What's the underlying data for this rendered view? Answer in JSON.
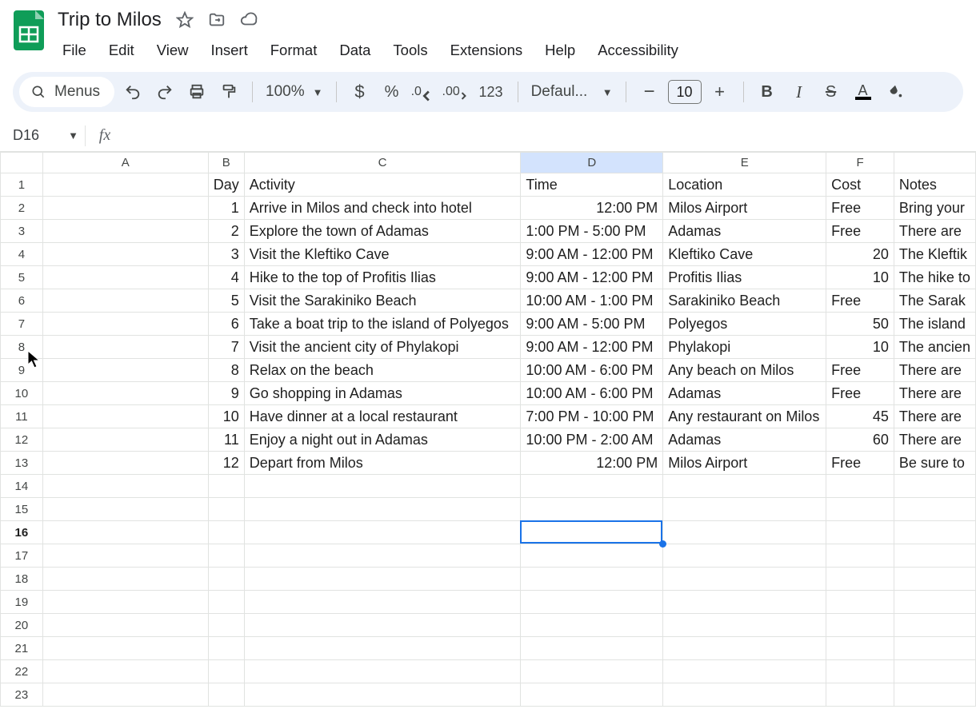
{
  "header": {
    "doc_title": "Trip to Milos",
    "menus": [
      "File",
      "Edit",
      "View",
      "Insert",
      "Format",
      "Data",
      "Tools",
      "Extensions",
      "Help",
      "Accessibility"
    ]
  },
  "toolbar": {
    "menus_label": "Menus",
    "zoom": "100%",
    "number_format_label": "123",
    "font_name": "Defaul...",
    "font_size": "10"
  },
  "fxbar": {
    "cell_ref": "D16",
    "formula": ""
  },
  "grid": {
    "columns": [
      "A",
      "B",
      "C",
      "D",
      "E",
      "F",
      ""
    ],
    "headers_row": [
      "",
      "Day",
      "Activity",
      "Time",
      "Location",
      "Cost",
      "Notes"
    ],
    "rows": [
      {
        "B": "1",
        "C": "Arrive in Milos and check into hotel",
        "D": "12:00 PM",
        "E": "Milos Airport",
        "F": "Free",
        "G": "Bring your"
      },
      {
        "B": "2",
        "C": "Explore the town of Adamas",
        "D": "1:00 PM - 5:00 PM",
        "E": "Adamas",
        "F": "Free",
        "G": "There are"
      },
      {
        "B": "3",
        "C": "Visit the Kleftiko Cave",
        "D": "9:00 AM - 12:00 PM",
        "E": "Kleftiko Cave",
        "F": "20",
        "G": "The Kleftik"
      },
      {
        "B": "4",
        "C": "Hike to the top of Profitis Ilias",
        "D": "9:00 AM - 12:00 PM",
        "E": "Profitis Ilias",
        "F": "10",
        "G": "The hike to"
      },
      {
        "B": "5",
        "C": "Visit the Sarakiniko Beach",
        "D": "10:00 AM - 1:00 PM",
        "E": "Sarakiniko Beach",
        "F": "Free",
        "G": "The Sarak"
      },
      {
        "B": "6",
        "C": "Take a boat trip to the island of Polyegos",
        "D": "9:00 AM - 5:00 PM",
        "E": "Polyegos",
        "F": "50",
        "G": "The island"
      },
      {
        "B": "7",
        "C": "Visit the ancient city of Phylakopi",
        "D": "9:00 AM - 12:00 PM",
        "E": "Phylakopi",
        "F": "10",
        "G": "The ancien"
      },
      {
        "B": "8",
        "C": "Relax on the beach",
        "D": "10:00 AM - 6:00 PM",
        "E": "Any beach on Milos",
        "F": "Free",
        "G": "There are"
      },
      {
        "B": "9",
        "C": "Go shopping in Adamas",
        "D": "10:00 AM - 6:00 PM",
        "E": "Adamas",
        "F": "Free",
        "G": "There are"
      },
      {
        "B": "10",
        "C": "Have dinner at a local restaurant",
        "D": "7:00 PM - 10:00 PM",
        "E": "Any restaurant on Milos",
        "F": "45",
        "G": "There are"
      },
      {
        "B": "11",
        "C": "Enjoy a night out in Adamas",
        "D": "10:00 PM - 2:00 AM",
        "E": "Adamas",
        "F": "60",
        "G": "There are"
      },
      {
        "B": "12",
        "C": "Depart from Milos",
        "D": "12:00 PM",
        "E": "Milos Airport",
        "F": "Free",
        "G": "Be sure to"
      }
    ],
    "total_rows": 23,
    "selected_col": "D",
    "selected_row": 16
  },
  "chart_data": {
    "type": "table",
    "title": "Trip to Milos",
    "columns": [
      "Day",
      "Activity",
      "Time",
      "Location",
      "Cost",
      "Notes"
    ],
    "rows": [
      [
        1,
        "Arrive in Milos and check into hotel",
        "12:00 PM",
        "Milos Airport",
        "Free",
        "Bring your"
      ],
      [
        2,
        "Explore the town of Adamas",
        "1:00 PM - 5:00 PM",
        "Adamas",
        "Free",
        "There are"
      ],
      [
        3,
        "Visit the Kleftiko Cave",
        "9:00 AM - 12:00 PM",
        "Kleftiko Cave",
        20,
        "The Kleftik"
      ],
      [
        4,
        "Hike to the top of Profitis Ilias",
        "9:00 AM - 12:00 PM",
        "Profitis Ilias",
        10,
        "The hike to"
      ],
      [
        5,
        "Visit the Sarakiniko Beach",
        "10:00 AM - 1:00 PM",
        "Sarakiniko Beach",
        "Free",
        "The Sarak"
      ],
      [
        6,
        "Take a boat trip to the island of Polyegos",
        "9:00 AM - 5:00 PM",
        "Polyegos",
        50,
        "The island"
      ],
      [
        7,
        "Visit the ancient city of Phylakopi",
        "9:00 AM - 12:00 PM",
        "Phylakopi",
        10,
        "The ancien"
      ],
      [
        8,
        "Relax on the beach",
        "10:00 AM - 6:00 PM",
        "Any beach on Milos",
        "Free",
        "There are"
      ],
      [
        9,
        "Go shopping in Adamas",
        "10:00 AM - 6:00 PM",
        "Adamas",
        "Free",
        "There are"
      ],
      [
        10,
        "Have dinner at a local restaurant",
        "7:00 PM - 10:00 PM",
        "Any restaurant on Milos",
        45,
        "There are"
      ],
      [
        11,
        "Enjoy a night out in Adamas",
        "10:00 PM - 2:00 AM",
        "Adamas",
        60,
        "There are"
      ],
      [
        12,
        "Depart from Milos",
        "12:00 PM",
        "Milos Airport",
        "Free",
        "Be sure to"
      ]
    ]
  }
}
